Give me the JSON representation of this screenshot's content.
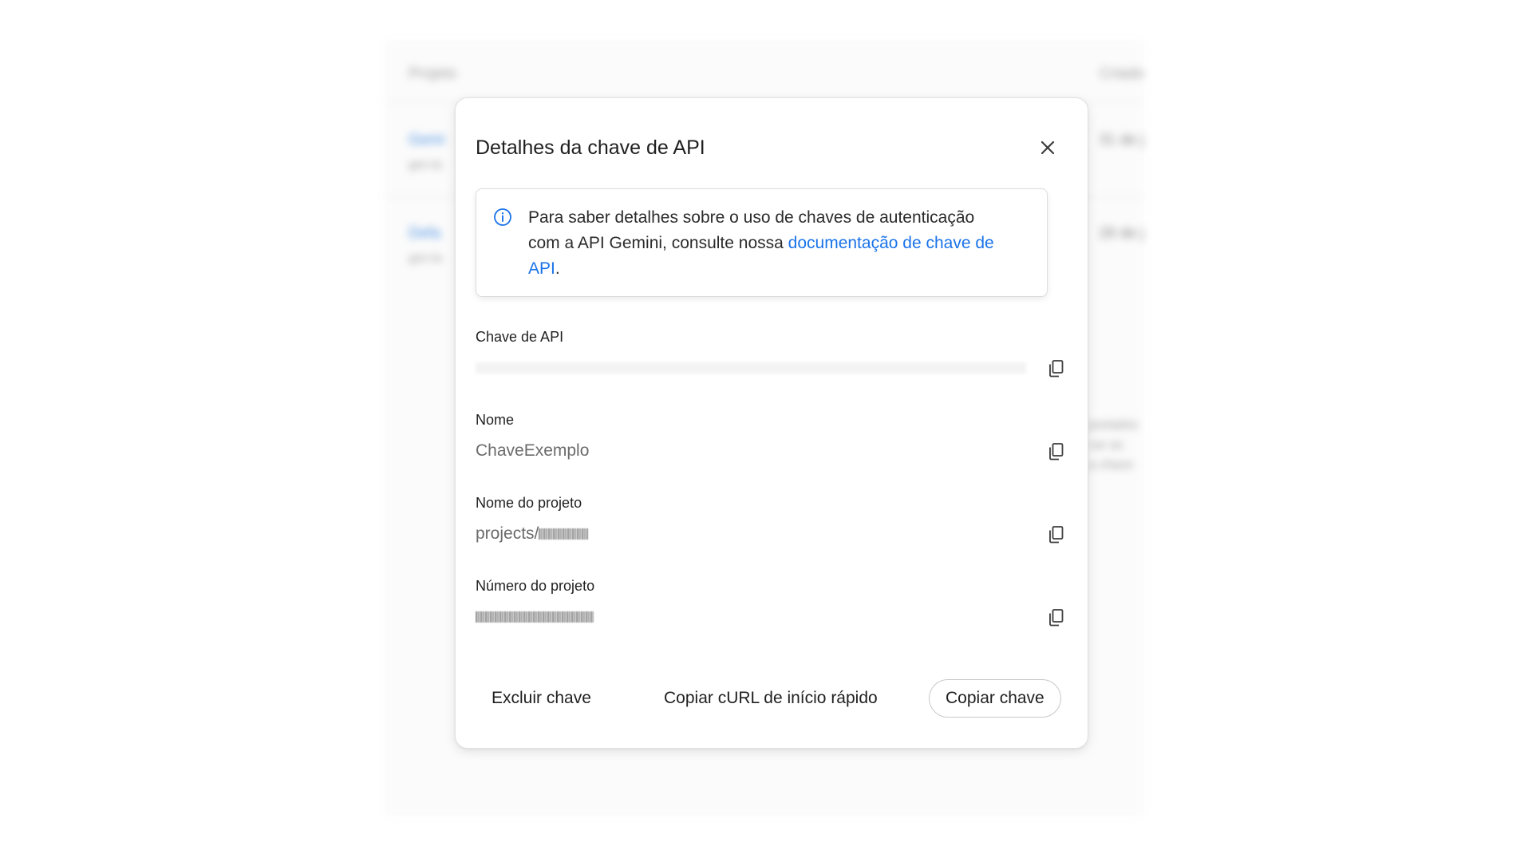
{
  "background": {
    "header_left": "Projeto",
    "header_right": "Criado",
    "rows": [
      {
        "title": "Gemi",
        "sub": "gen-la",
        "date": "31 de j"
      },
      {
        "title": "Defa",
        "sub": "gen-la",
        "date": "28 de j"
      }
    ],
    "side_text": "portados\ncar as\na chave"
  },
  "modal": {
    "title": "Detalhes da chave de API",
    "info": {
      "text": "Para saber detalhes sobre o uso de chaves de autenticação com a API Gemini, consulte nossa",
      "link_text": "documentação de chave de API",
      "trailing": "."
    },
    "fields": {
      "api_key": {
        "label": "Chave de API",
        "value": ""
      },
      "name": {
        "label": "Nome",
        "value": "ChaveExemplo"
      },
      "project_name": {
        "label": "Nome do projeto",
        "value": "projects/"
      },
      "project_number": {
        "label": "Número do projeto",
        "value": ""
      }
    },
    "footer": {
      "delete_label": "Excluir chave",
      "copy_curl_label": "Copiar cURL de início rápido",
      "copy_key_label": "Copiar chave"
    }
  },
  "icons": {
    "close": "close-icon",
    "info": "info-icon",
    "copy": "copy-icon"
  },
  "colors": {
    "link": "#1a73e8",
    "info_icon": "#1a73e8",
    "text": "#1f1f1f",
    "muted_value": "#6b6b6b"
  }
}
